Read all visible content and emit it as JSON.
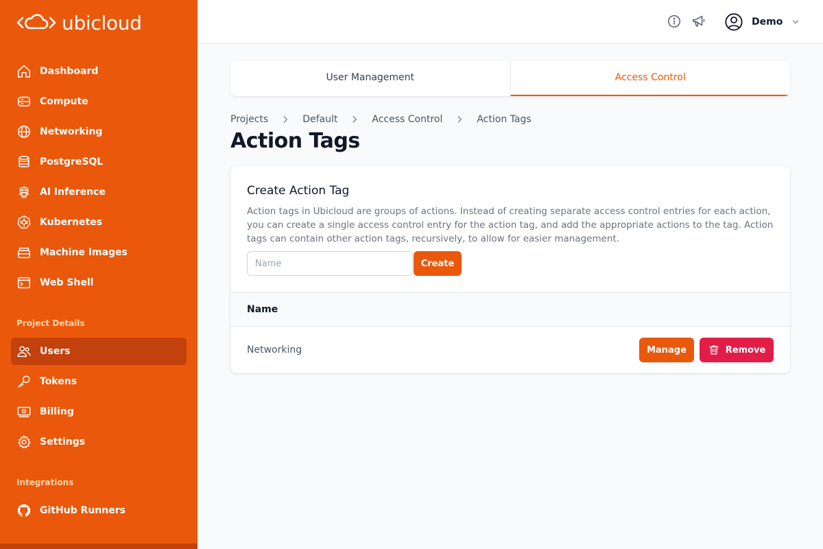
{
  "brand": {
    "name": "ubicloud",
    "sidebar_color": "#ea580c",
    "active_color": "#c2410c"
  },
  "sidebar": {
    "main_items": [
      {
        "label": "Dashboard",
        "icon": "home-icon"
      },
      {
        "label": "Compute",
        "icon": "server-icon"
      },
      {
        "label": "Networking",
        "icon": "globe-icon"
      },
      {
        "label": "PostgreSQL",
        "icon": "database-icon"
      },
      {
        "label": "AI Inference",
        "icon": "robot-icon"
      },
      {
        "label": "Kubernetes",
        "icon": "kubernetes-icon"
      },
      {
        "label": "Machine Images",
        "icon": "stack-icon"
      },
      {
        "label": "Web Shell",
        "icon": "terminal-icon"
      }
    ],
    "project_section_title": "Project Details",
    "project_items": [
      {
        "label": "Users",
        "icon": "users-icon",
        "active": true
      },
      {
        "label": "Tokens",
        "icon": "key-icon"
      },
      {
        "label": "Billing",
        "icon": "banknote-icon"
      },
      {
        "label": "Settings",
        "icon": "gear-icon"
      }
    ],
    "integrations_section_title": "Integrations",
    "integration_items": [
      {
        "label": "GitHub Runners",
        "icon": "github-icon"
      }
    ]
  },
  "topbar": {
    "user_name": "Demo"
  },
  "tabs": [
    {
      "label": "User Management",
      "active": false
    },
    {
      "label": "Access Control",
      "active": true
    }
  ],
  "breadcrumb": [
    "Projects",
    "Default",
    "Access Control",
    "Action Tags"
  ],
  "page_title": "Action Tags",
  "create_card": {
    "title": "Create Action Tag",
    "description": "Action tags in Ubicloud are groups of actions. Instead of creating separate access control entries for each action, you can create a single access control entry for the action tag, and add the appropriate actions to the tag. Action tags can contain other action tags, recursively, to allow for easier management.",
    "name_placeholder": "Name",
    "name_value": "",
    "create_label": "Create"
  },
  "table": {
    "header_name": "Name",
    "rows": [
      {
        "name": "Networking",
        "manage_label": "Manage",
        "remove_label": "Remove"
      }
    ]
  }
}
